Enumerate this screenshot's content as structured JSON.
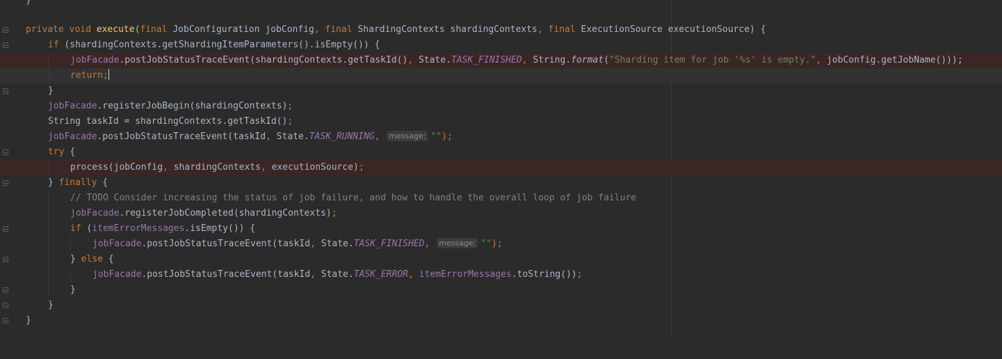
{
  "editor": {
    "lines": {
      "l0": {
        "brace": "}"
      },
      "l1": {
        "kw_private": "private",
        "kw_void": "void",
        "method": "execute",
        "p_open": "(",
        "kw_final1": "final",
        "t1": " JobConfiguration jobConfig",
        "c1": ", ",
        "kw_final2": "final",
        "t2": " ShardingContexts shardingContexts",
        "c2": ", ",
        "kw_final3": "final",
        "t3": " ExecutionSource executionSource) {"
      },
      "l2": {
        "kw_if": "if",
        "rest": " (shardingContexts.getShardingItemParameters().isEmpty()) {"
      },
      "l3": {
        "field": "jobFacade",
        "a": ".postJobStatusTraceEvent(shardingContexts.getTaskId()",
        "c1": ", ",
        "b": "State.",
        "const": "TASK_FINISHED",
        "c2": ", ",
        "c": "String.",
        "format": "format",
        "d": "(",
        "str": "\"Sharding item for job '%s' is empty.\"",
        "c3": ", ",
        "e": "jobConfig.getJobName()));"
      },
      "l4": {
        "kw_return": "return",
        "semi": ";"
      },
      "l5": {
        "brace": "}"
      },
      "l6": {
        "field": "jobFacade",
        "rest": ".registerJobBegin(shardingContexts)",
        "semi": ";"
      },
      "l7": {
        "a": "String taskId = shardingContexts.getTaskId()",
        "semi": ";"
      },
      "l8": {
        "field": "jobFacade",
        "a": ".postJobStatusTraceEvent(taskId",
        "c1": ", ",
        "b": "State.",
        "const": "TASK_RUNNING",
        "c2": ", ",
        "hint": "message:",
        "str": "\"\"",
        "end": ");"
      },
      "l9": {
        "kw_try": "try",
        "rest": " {"
      },
      "l10": {
        "a": "process(jobConfig",
        "c1": ", ",
        "b": "shardingContexts",
        "c2": ", ",
        "c": "executionSource)",
        "semi": ";"
      },
      "l11": {
        "brace": "} ",
        "kw_finally": "finally",
        "rest": " {"
      },
      "l12": {
        "comment": "// TODO Consider increasing the status of job failure, and how to handle the overall loop of job failure"
      },
      "l13": {
        "field": "jobFacade",
        "rest": ".registerJobCompleted(shardingContexts)",
        "semi": ";"
      },
      "l14": {
        "kw_if": "if",
        "p": " (",
        "field": "itemErrorMessages",
        "rest": ".isEmpty()) {"
      },
      "l15": {
        "field": "jobFacade",
        "a": ".postJobStatusTraceEvent(taskId",
        "c1": ", ",
        "b": "State.",
        "const": "TASK_FINISHED",
        "c2": ", ",
        "hint": "message:",
        "str": "\"\"",
        "end": ");"
      },
      "l16": {
        "brace": "} ",
        "kw_else": "else",
        "rest": " {"
      },
      "l17": {
        "field": "jobFacade",
        "a": ".postJobStatusTraceEvent(taskId",
        "c1": ", ",
        "b": "State.",
        "const": "TASK_ERROR",
        "c2": ", ",
        "field2": "itemErrorMessages",
        "c": ".toString())",
        "semi": ";"
      },
      "l18": {
        "brace": "}"
      },
      "l19": {
        "brace": "}"
      },
      "l20": {
        "brace": "}"
      }
    },
    "gutter_icons": [
      "fold-marker-icon",
      "lightbulb-intention-icon"
    ]
  },
  "colors": {
    "background": "#2b2b2b",
    "keyword": "#cc7832",
    "method_decl": "#ffc66d",
    "field": "#9876aa",
    "string": "#6a8759",
    "comment": "#808080",
    "error_line": "#3b2626",
    "default_text": "#a9b7c6"
  }
}
